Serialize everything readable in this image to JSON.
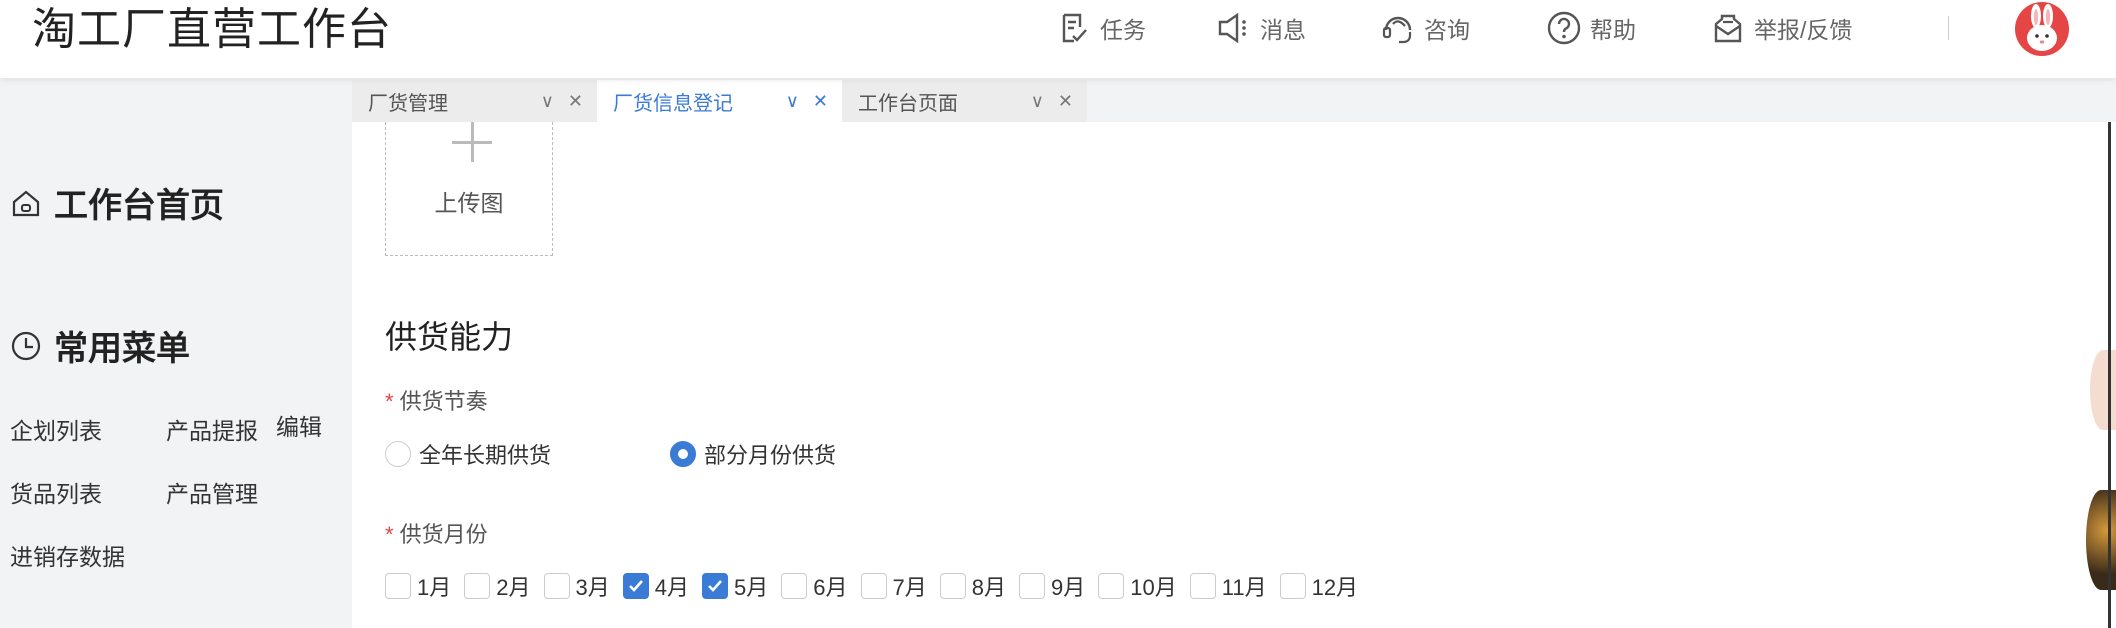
{
  "header": {
    "brand": "淘工厂直营工作台",
    "nav": [
      {
        "label": "任务",
        "icon": "task-icon"
      },
      {
        "label": "消息",
        "icon": "speaker-icon"
      },
      {
        "label": "咨询",
        "icon": "headset-icon"
      },
      {
        "label": "帮助",
        "icon": "help-icon"
      },
      {
        "label": "举报/反馈",
        "icon": "report-icon"
      }
    ],
    "avatar_icon": "bunny-avatar-icon"
  },
  "sidebar": {
    "home_label": "工作台首页",
    "common_label": "常用菜单",
    "edit_label": "编辑",
    "menu": [
      {
        "label": "企划列表"
      },
      {
        "label": "产品提报"
      },
      {
        "label": "货品列表"
      },
      {
        "label": "产品管理"
      },
      {
        "label": "进销存数据"
      }
    ]
  },
  "tabs": [
    {
      "label": "厂货管理",
      "active": false
    },
    {
      "label": "厂货信息登记",
      "active": true
    },
    {
      "label": "工作台页面",
      "active": false
    }
  ],
  "form": {
    "upload_label": "上传图",
    "section_title": "供货能力",
    "rhythm": {
      "label": "供货节奏",
      "options": [
        {
          "label": "全年长期供货",
          "selected": false
        },
        {
          "label": "部分月份供货",
          "selected": true
        }
      ]
    },
    "months": {
      "label": "供货月份",
      "options": [
        {
          "label": "1月",
          "checked": false
        },
        {
          "label": "2月",
          "checked": false
        },
        {
          "label": "3月",
          "checked": false
        },
        {
          "label": "4月",
          "checked": true
        },
        {
          "label": "5月",
          "checked": true
        },
        {
          "label": "6月",
          "checked": false
        },
        {
          "label": "7月",
          "checked": false
        },
        {
          "label": "8月",
          "checked": false
        },
        {
          "label": "9月",
          "checked": false
        },
        {
          "label": "10月",
          "checked": false
        },
        {
          "label": "11月",
          "checked": false
        },
        {
          "label": "12月",
          "checked": false
        }
      ]
    }
  },
  "colors": {
    "accent": "#3a7bd5",
    "required": "#e54545",
    "avatar_bg": "#e64545"
  }
}
